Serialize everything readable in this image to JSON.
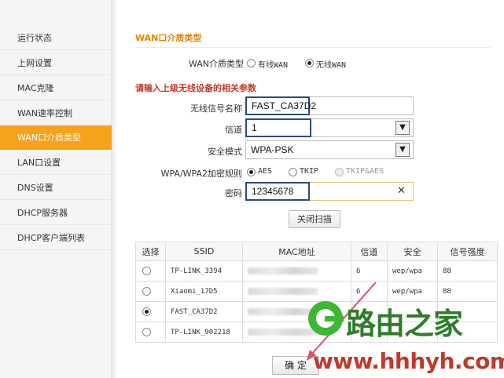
{
  "sidebar": {
    "items": [
      {
        "label": "运行状态"
      },
      {
        "label": "上网设置"
      },
      {
        "label": "MAC克隆"
      },
      {
        "label": "WAN速率控制"
      },
      {
        "label": "WAN口介质类型",
        "active": true
      },
      {
        "label": "LAN口设置"
      },
      {
        "label": "DNS设置"
      },
      {
        "label": "DHCP服务器"
      },
      {
        "label": "DHCP客户端列表"
      }
    ]
  },
  "section": {
    "title": "WAN口介质类型"
  },
  "wan_medium": {
    "label": "WAN介质类型",
    "options": [
      {
        "label": "有线WAN",
        "checked": false
      },
      {
        "label": "无线WAN",
        "checked": true
      }
    ]
  },
  "hint": "请输入上级无线设备的相关参数",
  "form": {
    "ssid": {
      "label": "无线信号名称",
      "value": "FAST_CA37D2"
    },
    "channel": {
      "label": "信道",
      "value": "1"
    },
    "security": {
      "label": "安全模式",
      "value": "WPA-PSK"
    },
    "encryption": {
      "label": "WPA/WPA2加密规则",
      "options": [
        {
          "label": "AES",
          "checked": true
        },
        {
          "label": "TKIP",
          "checked": false
        },
        {
          "label": "TKIP&AES",
          "checked": false,
          "disabled": true
        }
      ]
    },
    "password": {
      "label": "密码",
      "value": "12345678"
    }
  },
  "scan_button": "关闭扫描",
  "table": {
    "headers": [
      "选择",
      "SSID",
      "MAC地址",
      "信道",
      "安全",
      "信号强度"
    ],
    "rows": [
      {
        "ssid": "TP-LINK_3394",
        "channel": "6",
        "security": "wep/wpa",
        "signal": "88",
        "selected": false
      },
      {
        "ssid": "Xiaomi_17D5",
        "channel": "6",
        "security": "wep/wpa",
        "signal": "88",
        "selected": false
      },
      {
        "ssid": "FAST_CA37D2",
        "channel": "",
        "security": "",
        "signal": "",
        "selected": true
      },
      {
        "ssid": "TP-LINK_902218",
        "channel": "",
        "security": "",
        "signal": "",
        "selected": false
      }
    ]
  },
  "confirm_button": "确 定",
  "watermark": {
    "name": "路由之家",
    "url": "www.hhhyh.com"
  },
  "colors": {
    "accent": "#f7a21b",
    "highlight_border": "#2c4a7a",
    "hint": "#c0392b",
    "arrow": "#d9506a"
  }
}
